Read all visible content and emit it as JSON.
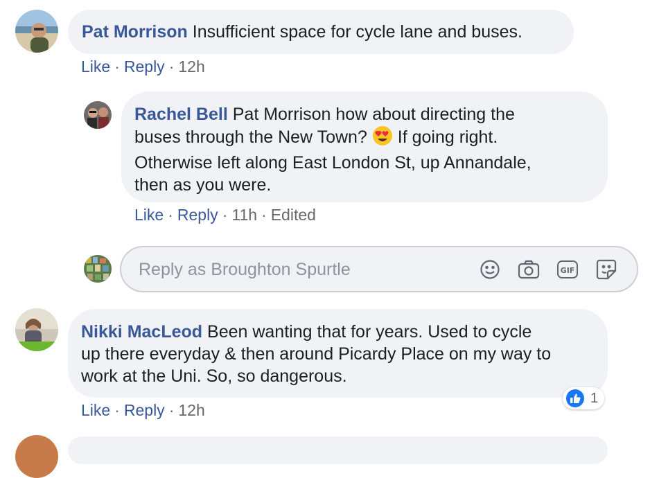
{
  "comments": [
    {
      "author": "Pat Morrison",
      "text": "Insufficient space for cycle lane and buses.",
      "actions": {
        "like": "Like",
        "reply": "Reply",
        "time": "12h"
      }
    },
    {
      "author": "Rachel Bell",
      "line1": "Pat Morrison how about directing the",
      "line2a": "buses through the New Town?",
      "emoji": "heart-eyes-emoji",
      "line2b": "If going right.",
      "line3": "Otherwise left along East London St, up Annandale,",
      "line4": "then as you were.",
      "actions": {
        "like": "Like",
        "reply": "Reply",
        "time": "11h",
        "edited": "Edited"
      }
    },
    {
      "author": "Nikki MacLeod",
      "line1": "Been wanting that for years. Used to cycle",
      "line2": "up there everyday & then around Picardy Place on my way to",
      "line3": "work at the Uni. So, so dangerous.",
      "actions": {
        "like": "Like",
        "reply": "Reply",
        "time": "12h"
      },
      "reaction_count": "1"
    }
  ],
  "reply_box": {
    "placeholder": "Reply as Broughton Spurtle",
    "icons": [
      "smiley-icon",
      "camera-icon",
      "gif-icon",
      "sticker-icon"
    ]
  },
  "colors": {
    "link": "#385898",
    "bubble": "#f0f2f5",
    "meta": "#65676b",
    "like_blue": "#1877f2"
  }
}
